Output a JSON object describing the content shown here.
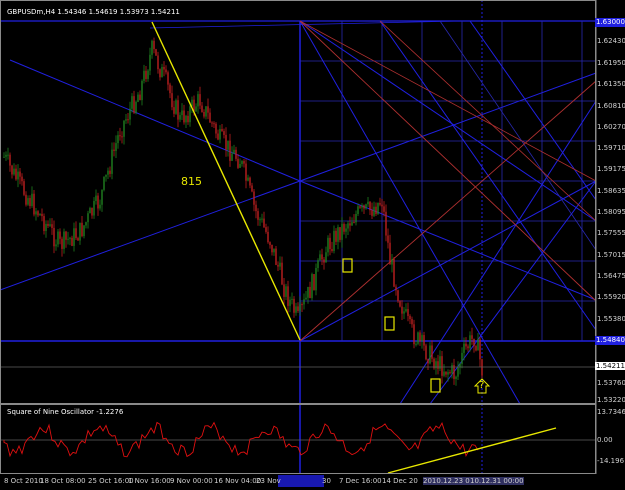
{
  "chart_title": "GBPUSDm,H4  1.54346  1.54619  1.53973  1.54211",
  "osc_title": "Square of Nine Oscillator -1.2276",
  "annotation": "815",
  "question": "?",
  "price_labels": [
    "1.62430",
    "1.61950",
    "1.61350",
    "1.60810",
    "1.60270",
    "1.59710",
    "1.59175",
    "1.58635",
    "1.58095",
    "1.57555",
    "1.57015",
    "1.56475",
    "1.55920",
    "1.55380",
    "1.54211",
    "1.53760",
    "1.53220"
  ],
  "highlight_top": "1.63000",
  "highlight_mid": "1.54840",
  "osc_labels": [
    "13.7346",
    "0.00",
    "-14.196"
  ],
  "time_labels": [
    "8 Oct 2010",
    "18 Oct 08:00",
    "25 Oct 16:00",
    "1 Nov 16:00",
    "9 Nov 00:00",
    "16 Nov 04:00",
    "23 Nov",
    "30",
    "7 Dec 16:00",
    "14 Dec 20",
    "2010.12.23 00:00",
    "10.12.31 00:00"
  ],
  "colors": {
    "background": "#000000",
    "grid_blue": "#2020e0",
    "grid_red": "#b03030",
    "trendline": "#e8e800",
    "bull_candle": "#208020",
    "bear_candle": "#c02020",
    "oscillator": "#e01010",
    "frame": "#8a8a8a"
  }
}
